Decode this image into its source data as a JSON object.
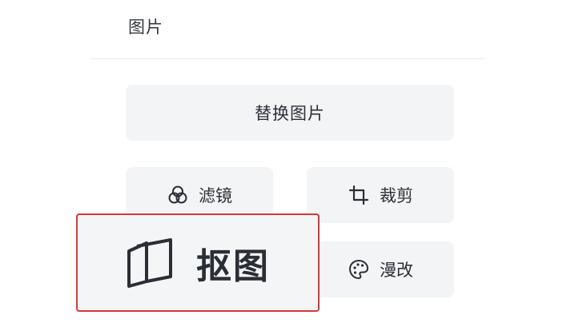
{
  "panel": {
    "section_title": "图片",
    "replace_label": "替换图片",
    "filter_label": "滤镜",
    "crop_label": "裁剪",
    "cutout_label": "抠图",
    "doodle_label": "漫改"
  },
  "icons": {
    "filter": "color-circles-icon",
    "crop": "crop-icon",
    "cutout": "cutout-icon",
    "doodle": "palette-icon"
  },
  "colors": {
    "highlight_border": "#d9373b",
    "button_bg": "#f3f4f6",
    "text": "#2b2f36"
  }
}
